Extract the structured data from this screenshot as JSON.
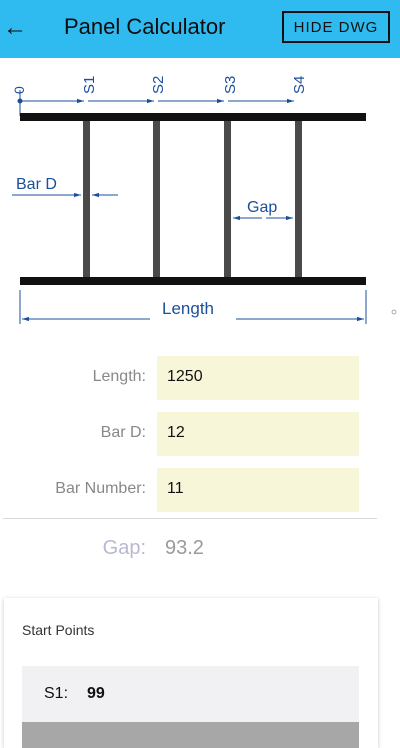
{
  "appbar": {
    "back_icon": "arrow-left-icon",
    "title": "Panel Calculator",
    "hide_button": "HIDE DWG",
    "color": "#2fbbf0"
  },
  "drawing": {
    "markers": [
      "0",
      "S1",
      "S2",
      "S3",
      "S4"
    ],
    "bar_d_label": "Bar D",
    "gap_label": "Gap",
    "length_label": "Length",
    "line_color": "#1b4f9b"
  },
  "form": {
    "length": {
      "label": "Length:",
      "value": "1250"
    },
    "bar_d": {
      "label": "Bar D:",
      "value": "12"
    },
    "bar_number": {
      "label": "Bar Number:",
      "value": "11"
    },
    "field_color": "#f7f6d9"
  },
  "result": {
    "gap_label": "Gap:",
    "gap_value": "93.2"
  },
  "start_points": {
    "title": "Start Points",
    "items": [
      {
        "key": "S1:",
        "value": "99"
      }
    ]
  }
}
